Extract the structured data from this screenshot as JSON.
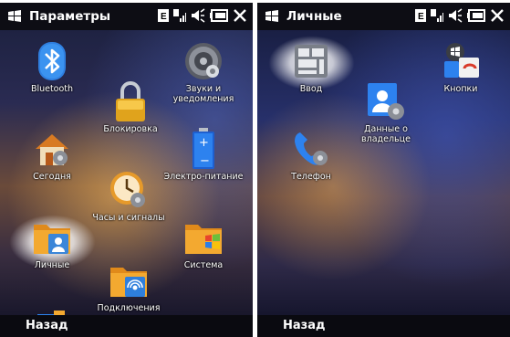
{
  "left": {
    "title": "Параметры",
    "softkey": "Назад",
    "items": [
      {
        "label": "Bluetooth",
        "icon": "bluetooth-icon"
      },
      {
        "label": "Звуки и уведомления",
        "icon": "sounds-icon"
      },
      {
        "label": "Блокировка",
        "icon": "lock-icon"
      },
      {
        "label": "Сегодня",
        "icon": "today-icon"
      },
      {
        "label": "Электро-питание",
        "icon": "battery-icon"
      },
      {
        "label": "Часы и сигналы",
        "icon": "clock-icon"
      },
      {
        "label": "Личные",
        "icon": "personal-folder-icon"
      },
      {
        "label": "Система",
        "icon": "system-folder-icon"
      },
      {
        "label": "Подключения",
        "icon": "connections-folder-icon"
      },
      {
        "label": "",
        "icon": "connection-device-icon"
      }
    ]
  },
  "right": {
    "title": "Личные",
    "softkey": "Назад",
    "items": [
      {
        "label": "Ввод",
        "icon": "input-keyboard-icon"
      },
      {
        "label": "Кнопки",
        "icon": "buttons-icon"
      },
      {
        "label": "Данные о владельце",
        "icon": "owner-info-icon"
      },
      {
        "label": "Телефон",
        "icon": "phone-icon"
      }
    ]
  },
  "status_icons": [
    "data-connection-icon",
    "signal-icon",
    "volume-icon",
    "battery-status-icon",
    "close-icon"
  ],
  "colors": {
    "titlebar": "#0d0d14",
    "text": "#ffffff",
    "highlight": "#ffffff"
  }
}
